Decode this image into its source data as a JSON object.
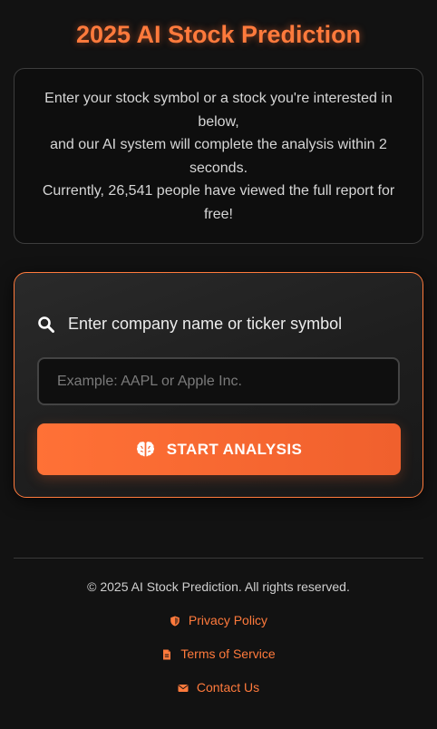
{
  "header": {
    "title": "2025 AI Stock Prediction"
  },
  "intro": {
    "line1": "Enter your stock symbol or a stock you're interested in below,",
    "line2": "and our AI system will complete the analysis within 2 seconds.",
    "line3": "Currently, 26,541 people have viewed the full report for free!"
  },
  "search": {
    "label": "Enter company name or ticker symbol",
    "icon": "search-icon",
    "input_value": "",
    "placeholder": "Example: AAPL or Apple Inc.",
    "button_label": "START ANALYSIS",
    "button_icon": "brain-icon"
  },
  "footer": {
    "copyright": "© 2025 AI Stock Prediction. All rights reserved.",
    "links": [
      {
        "label": "Privacy Policy",
        "icon": "shield-icon"
      },
      {
        "label": "Terms of Service",
        "icon": "document-icon"
      },
      {
        "label": "Contact Us",
        "icon": "envelope-icon"
      }
    ]
  },
  "colors": {
    "accent": "#ff7a3c",
    "background": "#121212",
    "card_border": "#3d3d3d"
  }
}
